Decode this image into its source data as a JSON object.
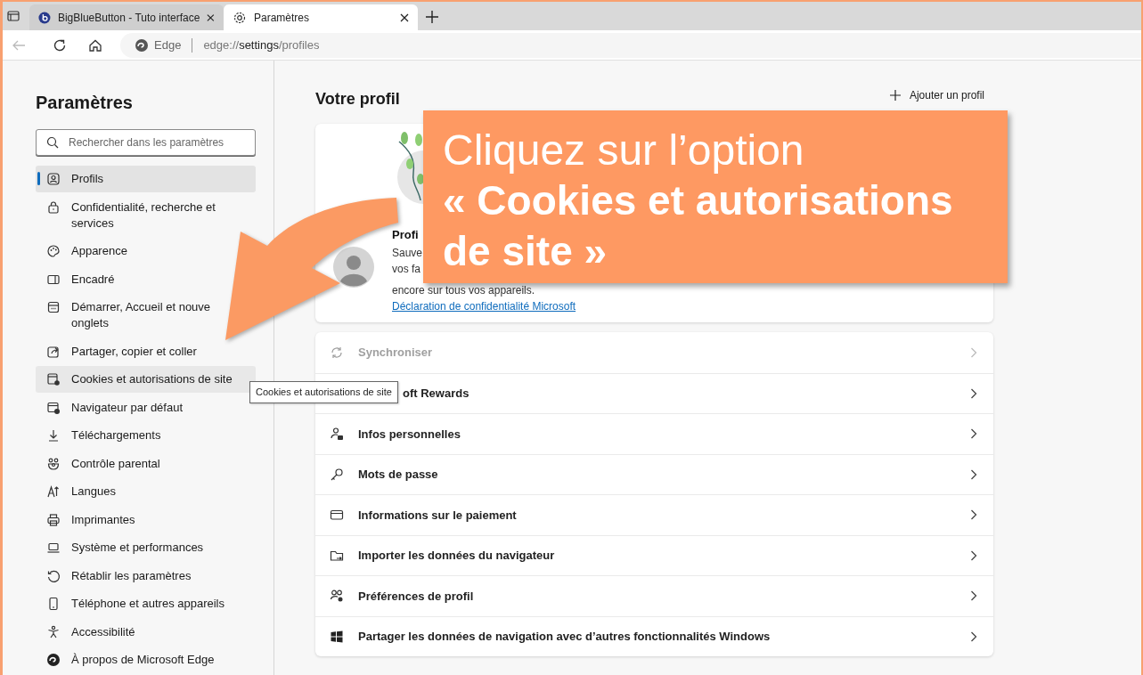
{
  "tabs": [
    {
      "label": "BigBlueButton - Tuto interface",
      "selected": false
    },
    {
      "label": "Paramètres",
      "selected": true
    }
  ],
  "address_bar": {
    "site_label": "Edge",
    "url_prefix": "edge://",
    "url_bold": "settings",
    "url_suffix": "/profiles"
  },
  "sidebar": {
    "title": "Paramètres",
    "search": {
      "placeholder": "Rechercher dans les paramètres"
    },
    "items": [
      {
        "label": "Profils",
        "selected": true,
        "hovered": false
      },
      {
        "label": "Confidentialité, recherche et services",
        "selected": false,
        "hovered": false
      },
      {
        "label": "Apparence",
        "selected": false,
        "hovered": false
      },
      {
        "label": "Encadré",
        "selected": false,
        "hovered": false
      },
      {
        "label": "Démarrer, Accueil et nouve",
        "label_line_2": "onglets",
        "selected": false,
        "hovered": false
      },
      {
        "label": "Partager, copier et coller",
        "selected": false,
        "hovered": false
      },
      {
        "label": "Cookies et autorisations de site",
        "selected": false,
        "hovered": true
      },
      {
        "label": "Navigateur par défaut",
        "selected": false,
        "hovered": false
      },
      {
        "label": "Téléchargements",
        "selected": false,
        "hovered": false
      },
      {
        "label": "Contrôle parental",
        "selected": false,
        "hovered": false
      },
      {
        "label": "Langues",
        "selected": false,
        "hovered": false
      },
      {
        "label": "Imprimantes",
        "selected": false,
        "hovered": false
      },
      {
        "label": "Système et performances",
        "selected": false,
        "hovered": false
      },
      {
        "label": "Rétablir les paramètres",
        "selected": false,
        "hovered": false
      },
      {
        "label": "Téléphone et autres appareils",
        "selected": false,
        "hovered": false
      },
      {
        "label": "Accessibilité",
        "selected": false,
        "hovered": false
      },
      {
        "label": "À propos de Microsoft Edge",
        "selected": false,
        "hovered": false
      }
    ]
  },
  "tooltip": "Cookies et autorisations de site",
  "main": {
    "title": "Votre profil",
    "add_profile": "Ajouter un profil",
    "profile_card": {
      "name": "Profi",
      "text_lines": [
        "Sauve",
        "vos fa"
      ],
      "text_last": "encore sur tous vos appareils.",
      "link": "Déclaration de confidentialité Microsoft"
    },
    "rows": [
      {
        "label": "Synchroniser",
        "disabled": true,
        "kind": "plain"
      },
      {
        "label": "oft Rewards",
        "disabled": false,
        "kind": "covered"
      },
      {
        "label": "Infos personnelles",
        "disabled": false,
        "kind": "plain"
      },
      {
        "label": "Mots de passe",
        "disabled": false,
        "kind": "plain"
      },
      {
        "label": "Informations sur le paiement",
        "disabled": false,
        "kind": "plain"
      },
      {
        "label": "Importer les données du navigateur",
        "disabled": false,
        "kind": "plain"
      },
      {
        "label": "Préférences de profil",
        "disabled": false,
        "kind": "plain"
      },
      {
        "label": "Partager les données de navigation avec d’autres fonctionnalités Windows",
        "disabled": false,
        "kind": "plain"
      }
    ]
  },
  "callout": {
    "line_1": "Cliquez sur l’option",
    "line_2": "« Cookies et autorisations de site »"
  }
}
